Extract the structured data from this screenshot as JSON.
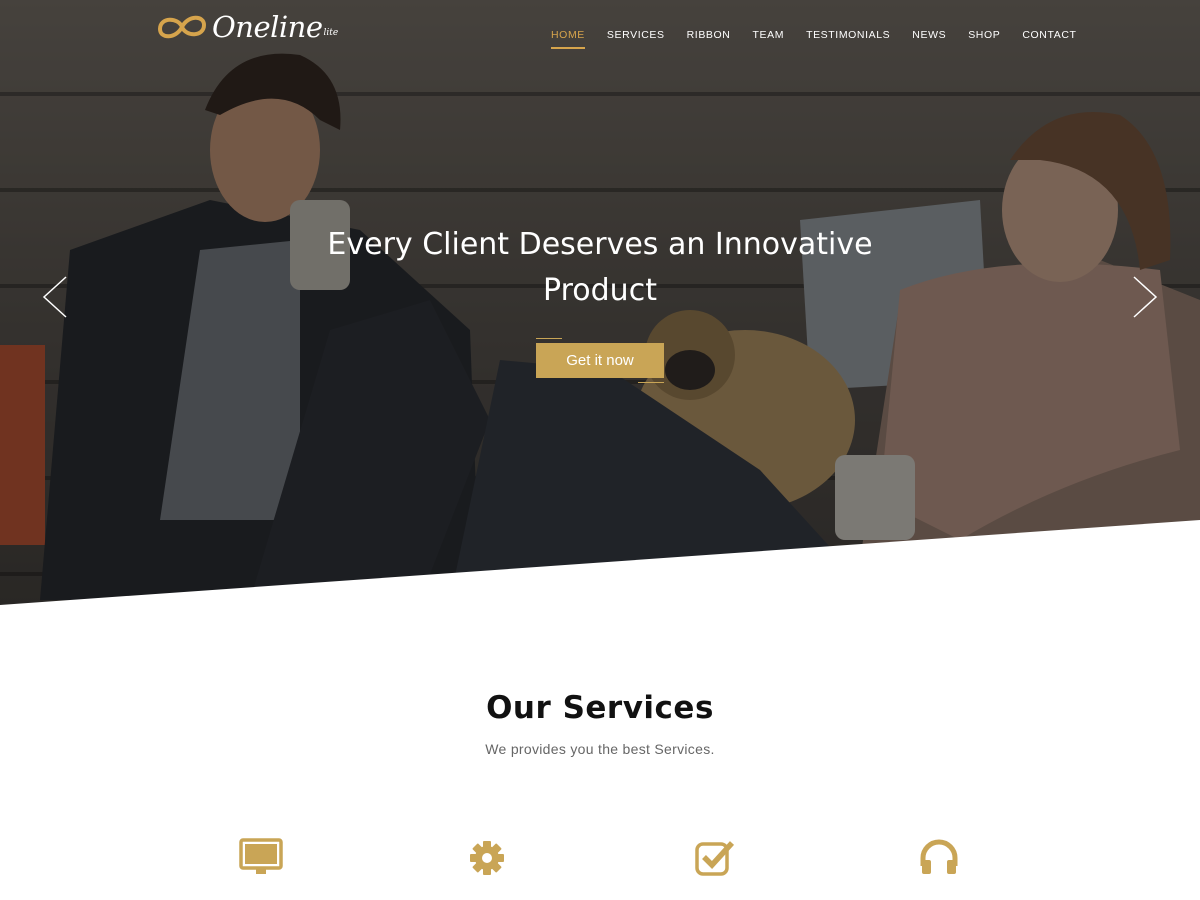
{
  "header": {
    "logo_text": "Oneline",
    "logo_sub": "lite",
    "nav": [
      {
        "label": "HOME",
        "active": true
      },
      {
        "label": "SERVICES",
        "active": false
      },
      {
        "label": "RIBBON",
        "active": false
      },
      {
        "label": "TEAM",
        "active": false
      },
      {
        "label": "TESTIMONIALS",
        "active": false
      },
      {
        "label": "NEWS",
        "active": false
      },
      {
        "label": "SHOP",
        "active": false
      },
      {
        "label": "CONTACT",
        "active": false
      }
    ]
  },
  "hero": {
    "title": "Every Client Deserves an Innovative Product",
    "button_label": "Get it now",
    "prev_icon": "chevron-left-icon",
    "next_icon": "chevron-right-icon"
  },
  "services": {
    "title": "Our Services",
    "subtitle": "We provides you the best Services.",
    "icons": [
      "desktop-icon",
      "gear-icon",
      "checkbox-icon",
      "headphones-icon"
    ]
  },
  "colors": {
    "accent": "#c9a556",
    "nav_active": "#d6a44c",
    "heading": "#111111",
    "subtext": "#666666"
  }
}
